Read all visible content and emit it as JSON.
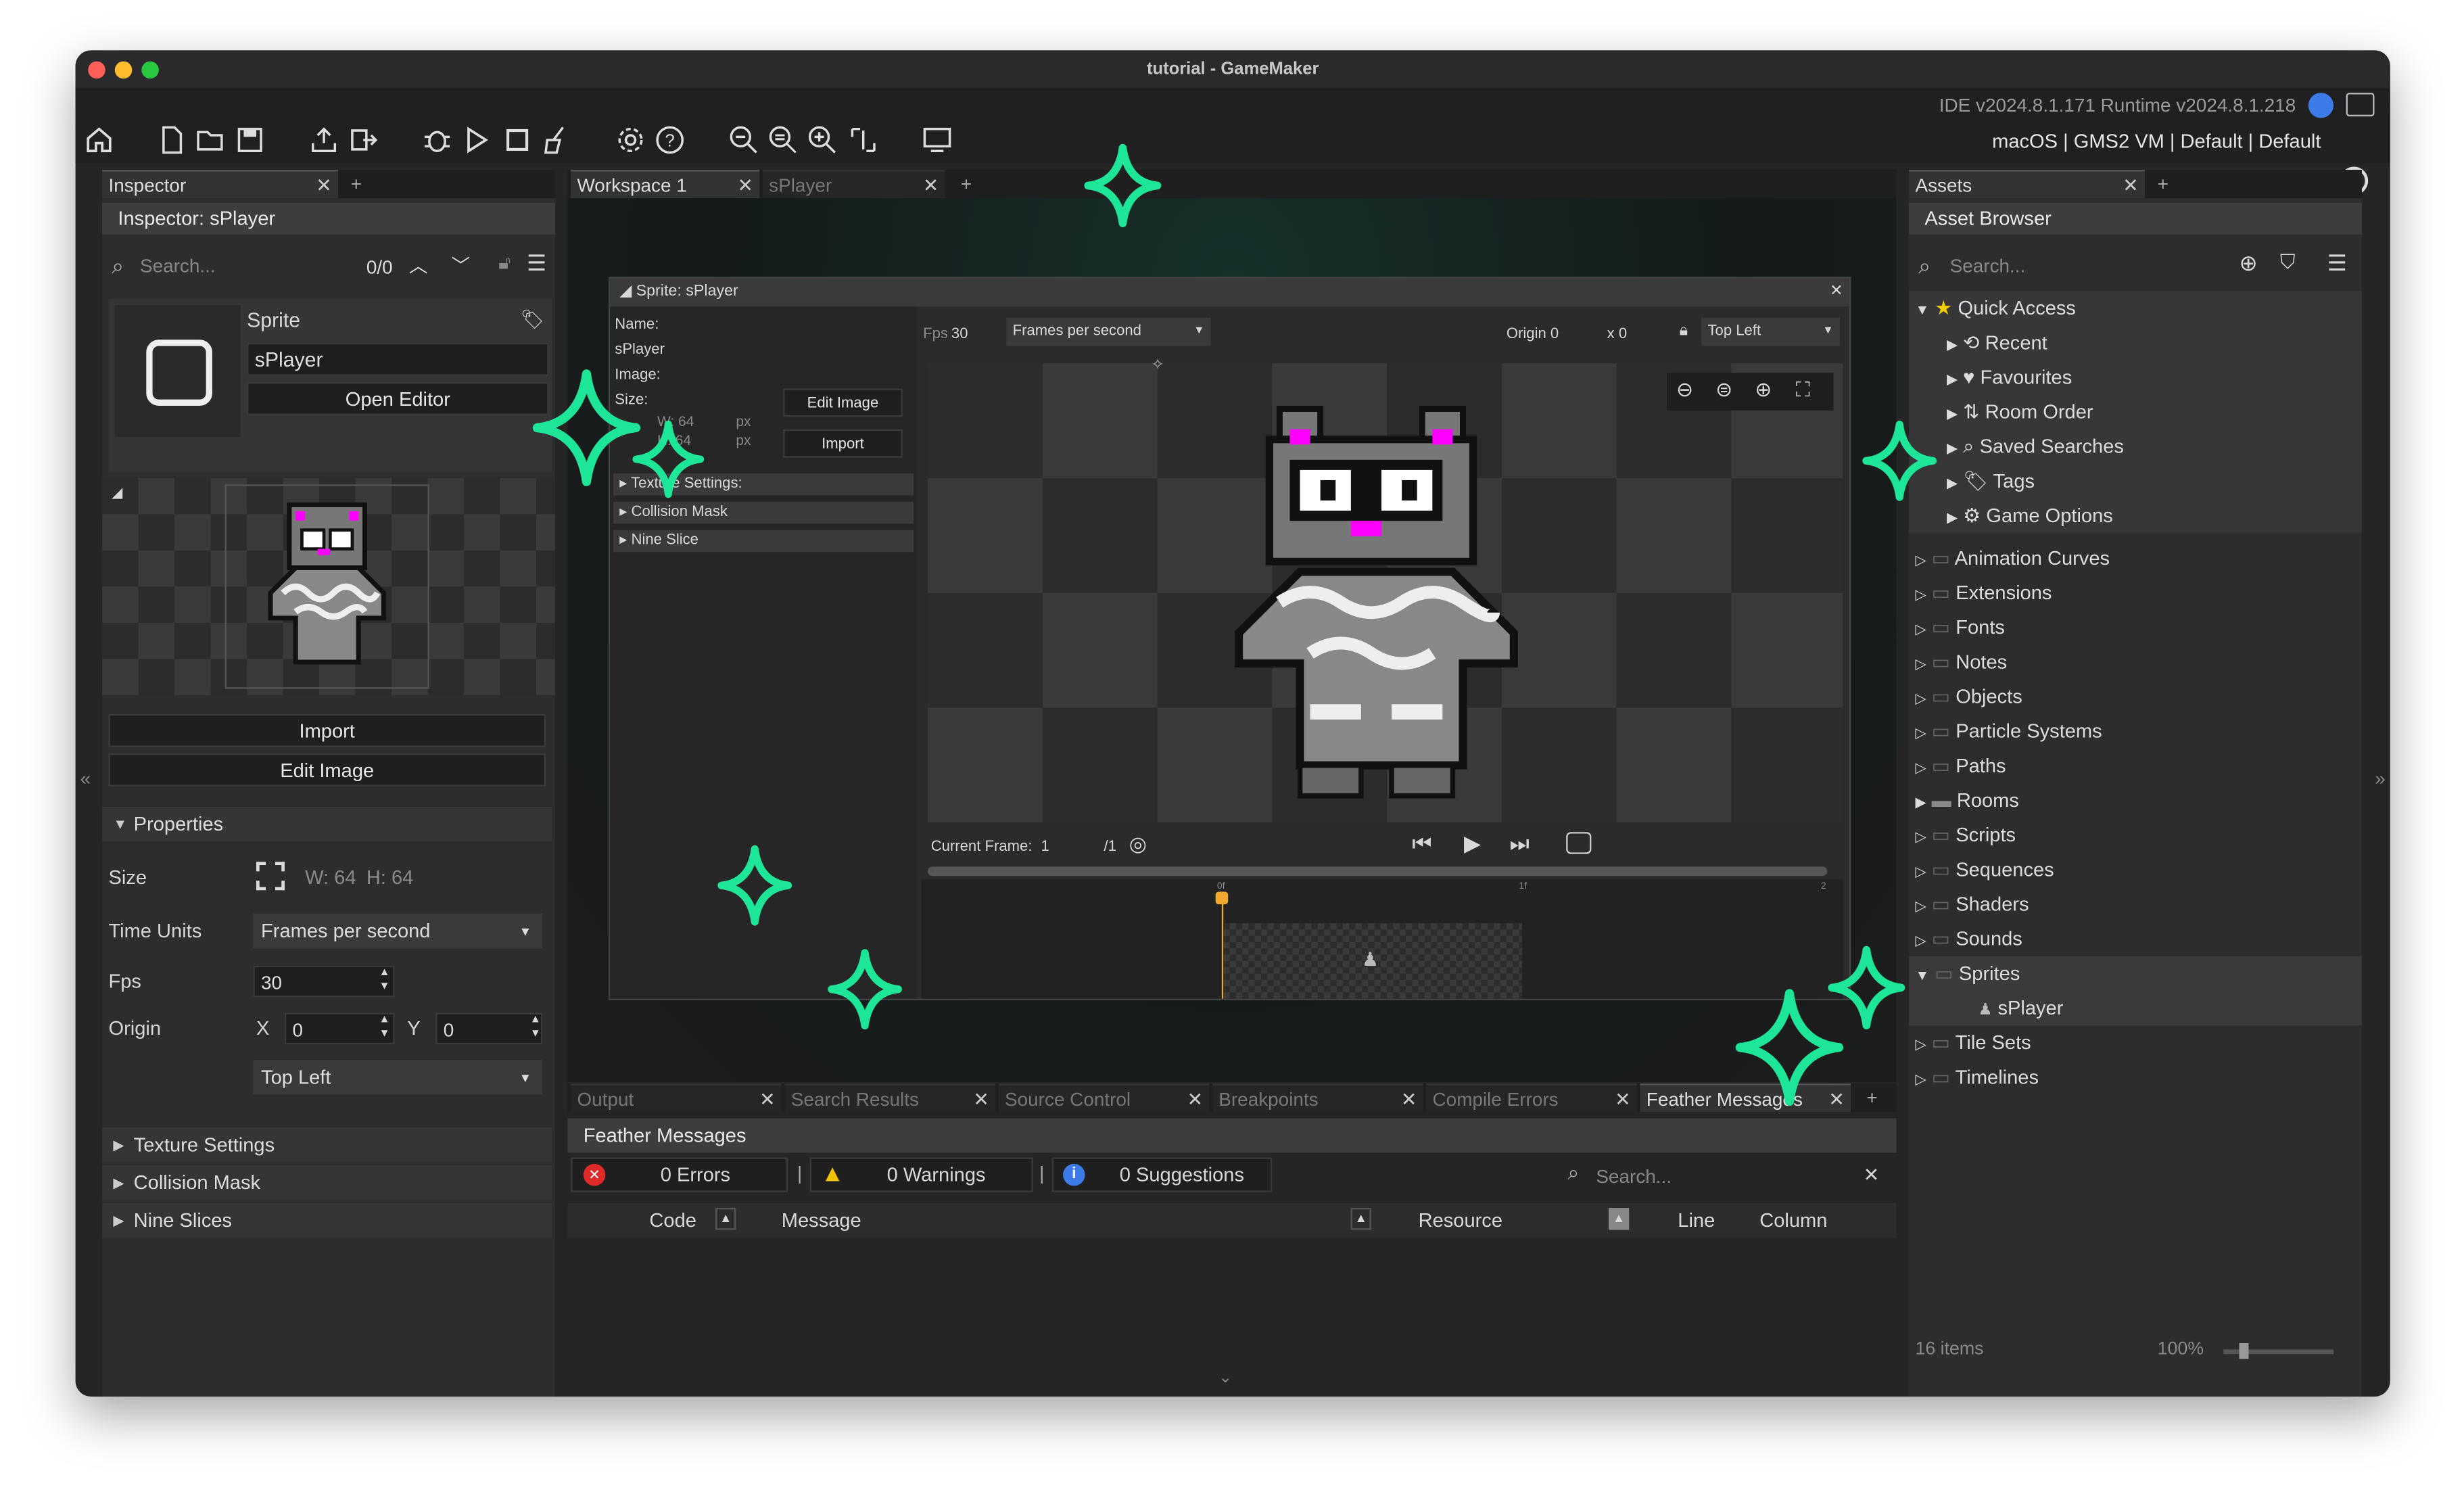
{
  "window": {
    "title": "tutorial - GameMaker"
  },
  "header": {
    "version": "IDE v2024.8.1.171  Runtime v2024.8.1.218",
    "platform": "macOS | GMS2 VM | Default | Default"
  },
  "inspector": {
    "tab": "Inspector",
    "header": "Inspector: sPlayer",
    "search_placeholder": "Search...",
    "match_count": "0/0",
    "type_label": "Sprite",
    "sprite_name": "sPlayer",
    "open_editor": "Open Editor",
    "import": "Import",
    "edit_image": "Edit Image",
    "properties": "Properties",
    "size_label": "Size",
    "size_w": "W: 64",
    "size_h": "H: 64",
    "time_units_label": "Time Units",
    "time_units_value": "Frames per second",
    "fps_label": "Fps",
    "fps_value": "30",
    "origin_label": "Origin",
    "x_label": "X",
    "x_value": "0",
    "y_label": "Y",
    "y_value": "0",
    "origin_preset": "Top Left",
    "sections": [
      "Texture Settings",
      "Collision Mask",
      "Nine Slices"
    ]
  },
  "workspace": {
    "tabs": [
      "Workspace 1",
      "sPlayer"
    ]
  },
  "sprite_window": {
    "title": "Sprite: sPlayer",
    "name_label": "Name:",
    "name_value": "sPlayer",
    "image_label": "Image:",
    "size_label": "Size:",
    "w": "W: 64",
    "h": "H: 64",
    "px": "px",
    "edit_image": "Edit Image",
    "import": "Import",
    "sections": [
      "Texture Settings:",
      "Collision Mask",
      "Nine Slice"
    ],
    "fps_label": "Fps",
    "fps_value": "30",
    "fps_mode": "Frames per second",
    "origin_label": "Origin 0",
    "origin_x": "x 0",
    "origin_preset": "Top Left",
    "current_frame_label": "Current Frame:",
    "current_frame": "1",
    "frame_total": "/1",
    "timeline_marks": [
      "0f",
      "1f",
      "2"
    ]
  },
  "output": {
    "tabs": [
      "Output",
      "Search Results",
      "Source Control",
      "Breakpoints",
      "Compile Errors",
      "Feather Messages"
    ],
    "header": "Feather Messages",
    "errors": "0 Errors",
    "warnings": "0 Warnings",
    "suggestions": "0 Suggestions",
    "search_placeholder": "Search...",
    "columns": [
      "Code",
      "Message",
      "Resource",
      "Line",
      "Column"
    ]
  },
  "assets": {
    "tab": "Assets",
    "header": "Asset Browser",
    "search_placeholder": "Search...",
    "quick_access": "Quick Access",
    "quick_items": [
      "Recent",
      "Favourites",
      "Room Order",
      "Saved Searches",
      "Tags",
      "Game Options"
    ],
    "folders": [
      "Animation Curves",
      "Extensions",
      "Fonts",
      "Notes",
      "Objects",
      "Particle Systems",
      "Paths",
      "Rooms",
      "Scripts",
      "Sequences",
      "Shaders",
      "Sounds",
      "Sprites",
      "Tile Sets",
      "Timelines"
    ],
    "sprite_child": "sPlayer",
    "count": "16 items",
    "zoom": "100%"
  },
  "colors": {
    "accent": "#1de699",
    "magenta": "#ff00ff",
    "errors_icon": "#e02a2a",
    "warnings_icon": "#f2c200",
    "info_icon": "#3c7be8"
  }
}
